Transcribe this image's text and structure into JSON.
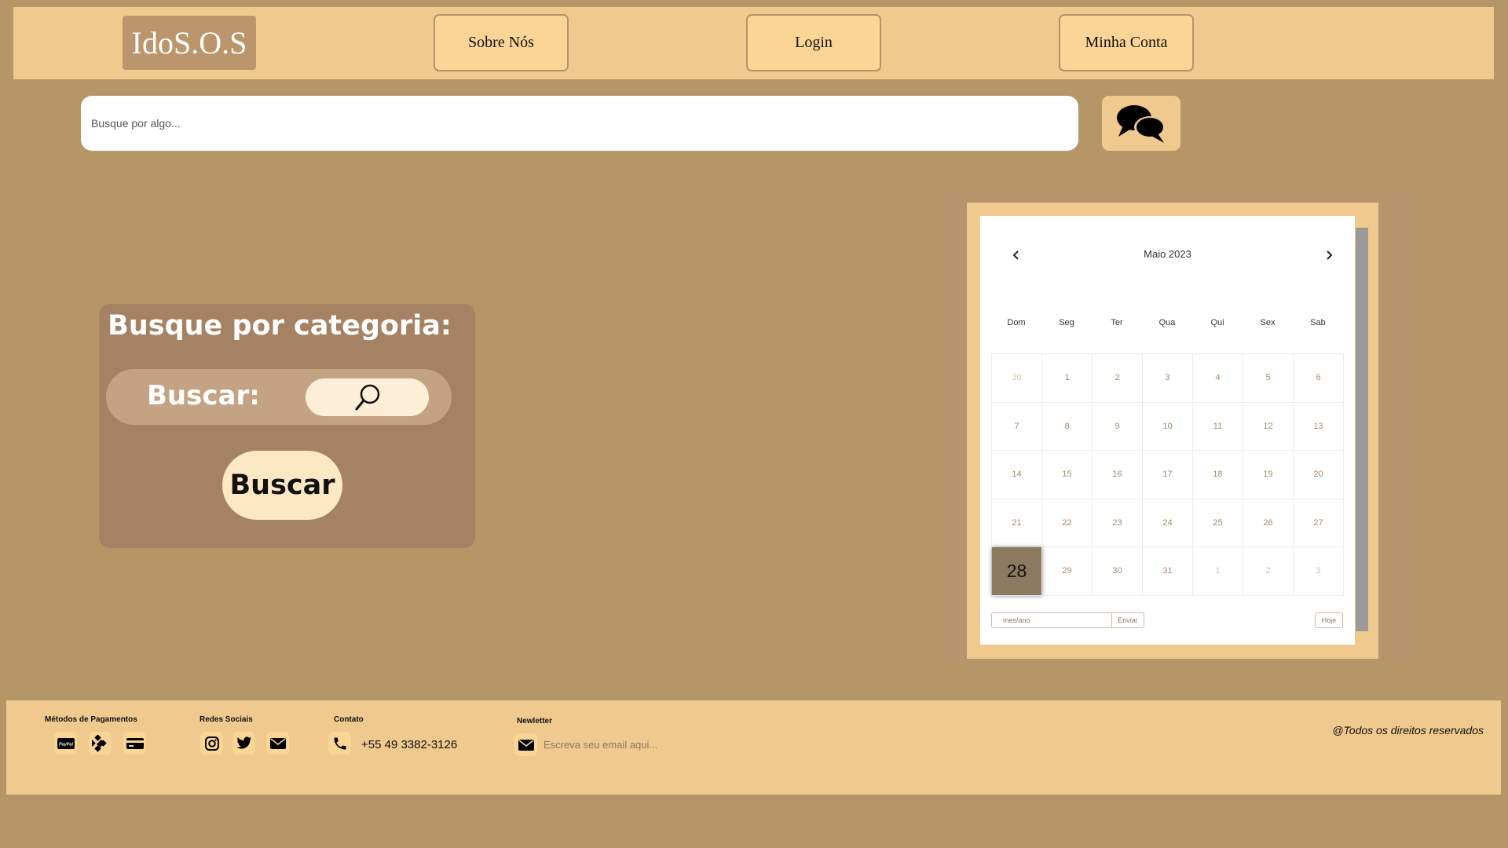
{
  "header": {
    "logo": "IdoS.O.S",
    "nav": {
      "about": "Sobre Nós",
      "login": "Login",
      "account": "Minha Conta"
    }
  },
  "search": {
    "placeholder": "Busque por algo...",
    "chat_icon": "chat-bubbles-icon"
  },
  "category": {
    "title": "Busque por categoria:",
    "row_label": "Buscar:",
    "search_icon": "magnifier-icon",
    "submit_label": "Buscar"
  },
  "calendar": {
    "month_label": "Maio 2023",
    "weekdays": [
      "Dom",
      "Seg",
      "Ter",
      "Qua",
      "Qui",
      "Sex",
      "Sab"
    ],
    "days": [
      {
        "label": "30",
        "muted": true
      },
      {
        "label": "1"
      },
      {
        "label": "2"
      },
      {
        "label": "3"
      },
      {
        "label": "4"
      },
      {
        "label": "5"
      },
      {
        "label": "6"
      },
      {
        "label": "7"
      },
      {
        "label": "8"
      },
      {
        "label": "9"
      },
      {
        "label": "10"
      },
      {
        "label": "11"
      },
      {
        "label": "12"
      },
      {
        "label": "13"
      },
      {
        "label": "14"
      },
      {
        "label": "15"
      },
      {
        "label": "16"
      },
      {
        "label": "17"
      },
      {
        "label": "18"
      },
      {
        "label": "19"
      },
      {
        "label": "20"
      },
      {
        "label": "21"
      },
      {
        "label": "22"
      },
      {
        "label": "23"
      },
      {
        "label": "24"
      },
      {
        "label": "25"
      },
      {
        "label": "26"
      },
      {
        "label": "27"
      },
      {
        "label": "28",
        "today": true
      },
      {
        "label": "29"
      },
      {
        "label": "30"
      },
      {
        "label": "31"
      },
      {
        "label": "1",
        "muted": true
      },
      {
        "label": "2",
        "muted": true
      },
      {
        "label": "3",
        "muted": true
      }
    ],
    "month_input_placeholder": "mes/ano",
    "send_label": "Enviar",
    "today_label": "Hoje"
  },
  "footer": {
    "payments": {
      "heading": "Métodos de Pagamentos",
      "icons": [
        "paypal-icon",
        "pix-icon",
        "credit-card-icon"
      ]
    },
    "social": {
      "heading": "Redes Sociais",
      "icons": [
        "instagram-icon",
        "twitter-icon",
        "email-icon"
      ]
    },
    "contact": {
      "heading": "Contato",
      "phone": "+55 49 3382-3126"
    },
    "newsletter": {
      "heading": "Newletter",
      "placeholder": "Escreva seu email aqui..."
    },
    "copyright": "@Todos os direitos reservados"
  },
  "colors": {
    "background": "#b59767",
    "header": "#efc98d",
    "button": "#fbd596",
    "logo_bg": "#bb966c",
    "category_box": "#a68265",
    "today_cell": "#8b7960"
  }
}
